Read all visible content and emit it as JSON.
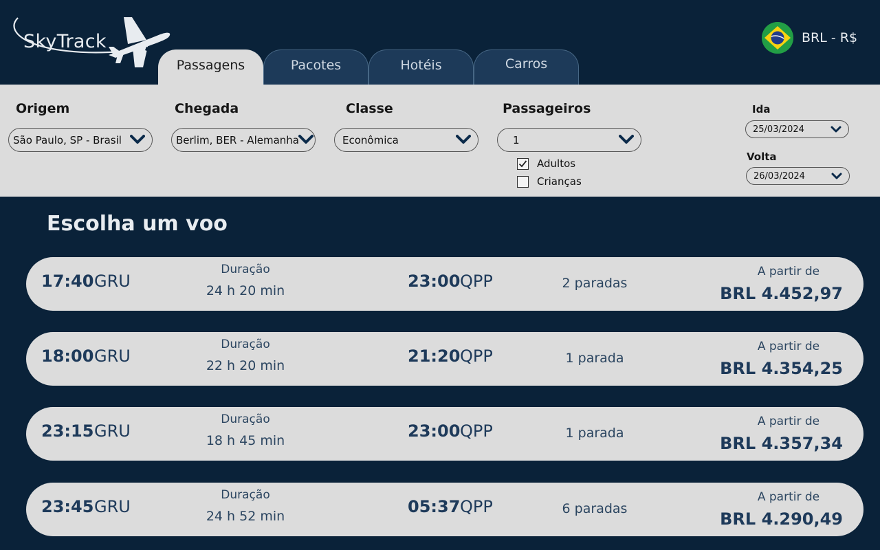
{
  "brand": {
    "name": "SkyTrack"
  },
  "tabs": [
    {
      "label": "Passagens"
    },
    {
      "label": "Pacotes"
    },
    {
      "label": "Hotéis"
    },
    {
      "label": "Carros"
    }
  ],
  "currency": {
    "label": "BRL - R$"
  },
  "search": {
    "origin": {
      "label": "Origem",
      "value": "São Paulo, SP - Brasil"
    },
    "destination": {
      "label": "Chegada",
      "value": "Berlim, BER - Alemanha"
    },
    "class": {
      "label": "Classe",
      "value": "Econômica"
    },
    "passengers": {
      "label": "Passageiros",
      "value": "1",
      "adults": {
        "label": "Adultos",
        "checked": true
      },
      "children": {
        "label": "Crianças",
        "checked": false
      }
    },
    "departure": {
      "label": "Ida",
      "value": "25/03/2024"
    },
    "return": {
      "label": "Volta",
      "value": "26/03/2024"
    }
  },
  "results": {
    "title": "Escolha um voo",
    "duration_label": "Duração",
    "from_label": "A partir de",
    "flights": [
      {
        "dep_time": "17:40",
        "dep_code": "GRU",
        "duration": "24 h 20 min",
        "arr_time": "23:00",
        "arr_code": "QPP",
        "stops": "2 paradas",
        "price": "BRL 4.452,97"
      },
      {
        "dep_time": "18:00",
        "dep_code": "GRU",
        "duration": "22 h 20 min",
        "arr_time": "21:20",
        "arr_code": "QPP",
        "stops": "1 parada",
        "price": "BRL 4.354,25"
      },
      {
        "dep_time": "23:15",
        "dep_code": "GRU",
        "duration": "18 h 45 min",
        "arr_time": "23:00",
        "arr_code": "QPP",
        "stops": "1 parada",
        "price": "BRL 4.357,34"
      },
      {
        "dep_time": "23:45",
        "dep_code": "GRU",
        "duration": "24 h 52 min",
        "arr_time": "05:37",
        "arr_code": "QPP",
        "stops": "6 paradas",
        "price": "BRL 4.290,49"
      }
    ]
  },
  "colors": {
    "background": "#0a2239",
    "panel": "#dcdcdc",
    "tab_inactive": "#1d3a59",
    "text_dark_blue": "#1e3a5a"
  }
}
